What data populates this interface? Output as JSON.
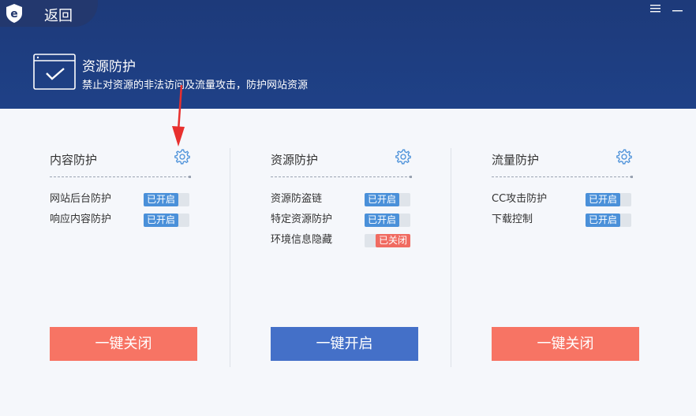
{
  "header": {
    "back_label": "返回",
    "title": "资源防护",
    "description": "禁止对资源的非法访问及流量攻击，防护网站资源"
  },
  "window": {
    "menu_icon": "menu-icon",
    "minimize_icon": "minimize-icon"
  },
  "colors": {
    "header_bg": "#1f4187",
    "on": "#4a90d9",
    "off": "#f06b61",
    "btn_close": "#f77464",
    "btn_open": "#4470c8"
  },
  "cards": [
    {
      "title": "内容防护",
      "items": [
        {
          "label": "网站后台防护",
          "state": "已开启",
          "on": true
        },
        {
          "label": "响应内容防护",
          "state": "已开启",
          "on": true
        }
      ],
      "button": "一键关闭",
      "button_type": "close"
    },
    {
      "title": "资源防护",
      "items": [
        {
          "label": "资源防盗链",
          "state": "已开启",
          "on": true
        },
        {
          "label": "特定资源防护",
          "state": "已开启",
          "on": true
        },
        {
          "label": "环境信息隐藏",
          "state": "已关闭",
          "on": false
        }
      ],
      "button": "一键开启",
      "button_type": "open"
    },
    {
      "title": "流量防护",
      "items": [
        {
          "label": "CC攻击防护",
          "state": "已开启",
          "on": true
        },
        {
          "label": "下载控制",
          "state": "已开启",
          "on": true
        }
      ],
      "button": "一键关闭",
      "button_type": "close"
    }
  ]
}
